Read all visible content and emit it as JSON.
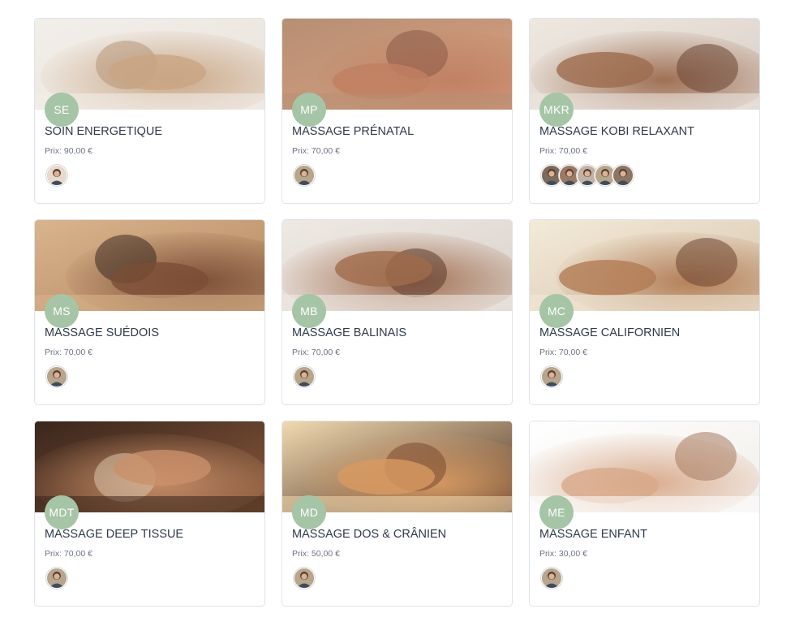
{
  "theme": {
    "initials_bg": "#a6c4a6",
    "title_color": "#2d3a4a",
    "price_color": "#6b7280",
    "card_border": "#dfe3e8"
  },
  "services": [
    {
      "initials": "SE",
      "name": "SOIN ENERGETIQUE",
      "price": "Prix: 90,00 €",
      "image": "woman-reclining-energy-healing",
      "palette": [
        "#e9e3dc",
        "#c9a583",
        "#f2eee9",
        "#b79578"
      ],
      "staff": [
        {
          "icon": "practitioner-avatar",
          "tone": "#e7d9cc"
        }
      ]
    },
    {
      "initials": "MP",
      "name": "MASSAGE PRÉNATAL",
      "price": "Prix: 70,00 €",
      "image": "prenatal-belly-massage",
      "palette": [
        "#d99f80",
        "#c07f62",
        "#b78f74",
        "#8a5a45"
      ],
      "staff": [
        {
          "icon": "practitioner-avatar",
          "tone": "#b7a58c"
        }
      ]
    },
    {
      "initials": "MKR",
      "name": "MASSAGE KOBI RELAXANT",
      "price": "Prix: 70,00 €",
      "image": "face-massage-woman",
      "palette": [
        "#d8cfc7",
        "#9c6b4e",
        "#efe8e1",
        "#6b4634"
      ],
      "staff": [
        {
          "icon": "practitioner-avatar",
          "tone": "#7d6a5d"
        },
        {
          "icon": "practitioner-avatar",
          "tone": "#9a7a64"
        },
        {
          "icon": "practitioner-avatar",
          "tone": "#c2b2a6"
        },
        {
          "icon": "practitioner-avatar",
          "tone": "#b7a58c"
        },
        {
          "icon": "practitioner-avatar",
          "tone": "#8c7563"
        }
      ]
    },
    {
      "initials": "MS",
      "name": "MASSAGE SUÉDOIS",
      "price": "Prix: 70,00 €",
      "image": "back-massage-man-stones",
      "palette": [
        "#b58862",
        "#7a4e36",
        "#d9b48c",
        "#3d2a21"
      ],
      "staff": [
        {
          "icon": "practitioner-avatar",
          "tone": "#b7a58c"
        }
      ]
    },
    {
      "initials": "MB",
      "name": "MASSAGE BALINAIS",
      "price": "Prix: 70,00 €",
      "image": "shoulder-massage-woman-smiling",
      "palette": [
        "#d9d2cc",
        "#a06b4c",
        "#efe9e3",
        "#5b3a2b"
      ],
      "staff": [
        {
          "icon": "practitioner-avatar",
          "tone": "#b7a58c"
        }
      ]
    },
    {
      "initials": "MC",
      "name": "MASSAGE CALIFORNIEN",
      "price": "Prix: 70,00 €",
      "image": "candle-back-massage",
      "palette": [
        "#d8c6ad",
        "#b27c55",
        "#f3ead9",
        "#6e4532"
      ],
      "staff": [
        {
          "icon": "practitioner-avatar",
          "tone": "#b7a58c"
        }
      ]
    },
    {
      "initials": "MDT",
      "name": "MASSAGE DEEP TISSUE",
      "price": "Prix: 70,00 €",
      "image": "deep-tissue-massage-towels",
      "palette": [
        "#8b5a3c",
        "#c9906a",
        "#3a261c",
        "#d8c5ac"
      ],
      "staff": [
        {
          "icon": "practitioner-avatar",
          "tone": "#b7a58c"
        }
      ]
    },
    {
      "initials": "MD",
      "name": "MASSAGE DOS & CRÂNIEN",
      "price": "Prix: 50,00 €",
      "image": "candlelit-back-head-massage",
      "palette": [
        "#4a2f22",
        "#d89a62",
        "#f1d9b0",
        "#7a4a30"
      ],
      "staff": [
        {
          "icon": "practitioner-avatar",
          "tone": "#b7a58c"
        }
      ]
    },
    {
      "initials": "ME",
      "name": "MASSAGE ENFANT",
      "price": "Prix: 30,00 €",
      "image": "child-shoulder-massage",
      "palette": [
        "#f1eeea",
        "#d8a98a",
        "#ffffff",
        "#a87a5e"
      ],
      "staff": [
        {
          "icon": "practitioner-avatar",
          "tone": "#b7a58c"
        }
      ]
    }
  ]
}
